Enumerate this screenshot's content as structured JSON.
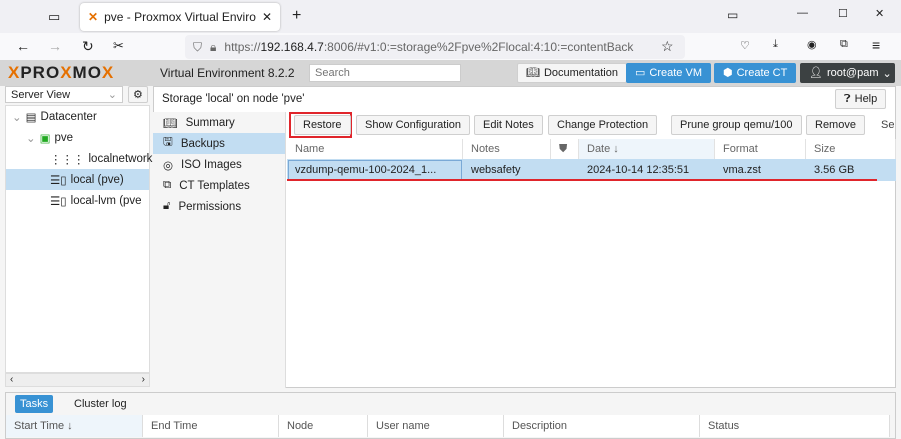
{
  "browser": {
    "tab_title": "pve - Proxmox Virtual Environm",
    "url_prefix": "https://",
    "url_host": "192.168.4.7",
    "url_rest": ":8006/#v1:0:=storage%2Fpve%2Flocal:4:10:=contentBack"
  },
  "header": {
    "logo": "PROXMOX",
    "version": "Virtual Environment 8.2.2",
    "search_placeholder": "Search",
    "documentation": "Documentation",
    "create_vm": "Create VM",
    "create_ct": "Create CT",
    "user": "root@pam"
  },
  "sidebar": {
    "view": "Server View",
    "tree": [
      {
        "label": "Datacenter"
      },
      {
        "label": "pve"
      },
      {
        "label": "localnetwork (p"
      },
      {
        "label": "local (pve)"
      },
      {
        "label": "local-lvm (pve"
      }
    ]
  },
  "main": {
    "title": "Storage 'local' on node 'pve'",
    "help": "Help",
    "nav": [
      {
        "label": "Summary"
      },
      {
        "label": "Backups"
      },
      {
        "label": "ISO Images"
      },
      {
        "label": "CT Templates"
      },
      {
        "label": "Permissions"
      }
    ],
    "toolbar": {
      "restore": "Restore",
      "show_config": "Show Configuration",
      "edit_notes": "Edit Notes",
      "change_protection": "Change Protection",
      "prune": "Prune group qemu/100",
      "remove": "Remove",
      "search_partial": "Se"
    },
    "columns": [
      "Name",
      "Notes",
      "",
      "Date ↓",
      "Format",
      "Size"
    ],
    "rows": [
      {
        "name": "vzdump-qemu-100-2024_1...",
        "notes": "websafety",
        "date": "2024-10-14 12:35:51",
        "format": "vma.zst",
        "size": "3.56 GB"
      }
    ]
  },
  "bottom": {
    "tabs": [
      "Tasks",
      "Cluster log"
    ],
    "columns": [
      "Start Time ↓",
      "End Time",
      "Node",
      "User name",
      "Description",
      "Status"
    ]
  }
}
